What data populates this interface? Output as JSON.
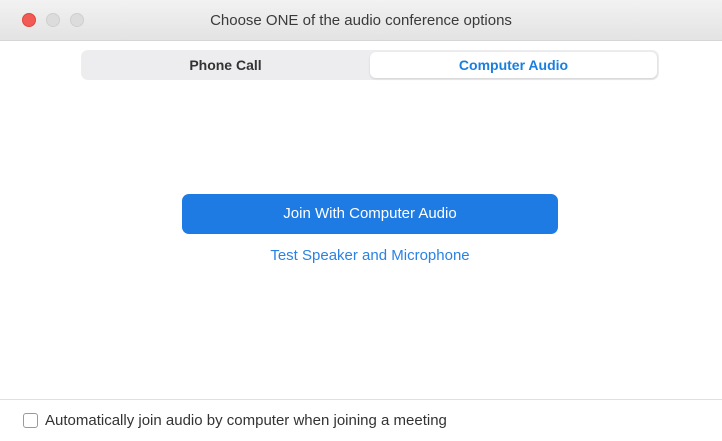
{
  "window": {
    "title": "Choose ONE of the audio conference options"
  },
  "tabs": [
    {
      "label": "Phone Call",
      "selected": false
    },
    {
      "label": "Computer Audio",
      "selected": true
    }
  ],
  "main": {
    "join_button_label": "Join With Computer Audio",
    "test_link_label": "Test Speaker and Microphone"
  },
  "footer": {
    "auto_join_label": "Automatically join audio by computer when joining a meeting",
    "auto_join_checked": false
  },
  "colors": {
    "accent": "#1e7be4",
    "close": "#f25b55"
  }
}
